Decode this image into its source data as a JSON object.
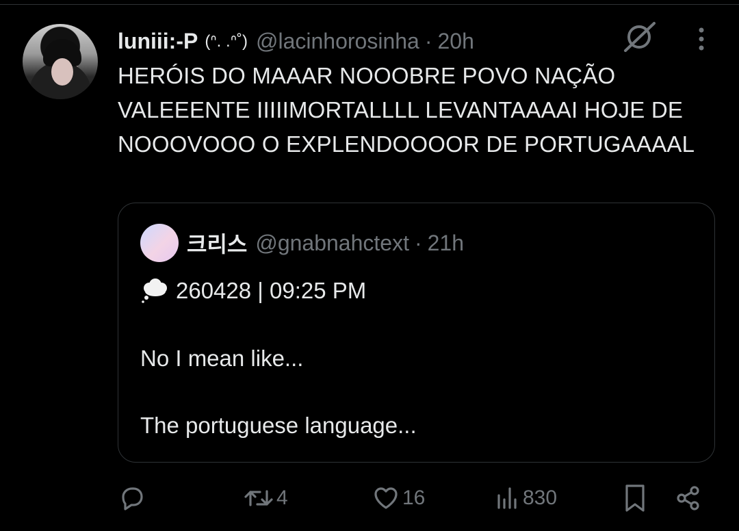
{
  "tweet": {
    "author_name": "luniii:-P",
    "author_emote": "(ᐢ. .ᐢ˚)",
    "handle": "@lacinhorosinha",
    "separator": "·",
    "time": "20h",
    "text": "HERÓIS DO MAAAR NOOOBRE POVO NAÇÃO VALEEENTE IIIIIMORTALLLL LEVANTAAAAI HOJE DE NOOOVOOO O EXPLENDOOOOR DE PORTUGAAAAL"
  },
  "quote": {
    "author_name": "크리스",
    "handle": "@gnabnahctext",
    "separator": "·",
    "time": "21h",
    "line1": "260428 | 09:25 PM",
    "line2": "No I mean like...",
    "line3": "The portuguese language..."
  },
  "actions": {
    "reply_count": "",
    "retweet_count": "4",
    "like_count": "16",
    "views_count": "830"
  },
  "icons": [
    "grok-icon",
    "more-icon",
    "thought-cloud-icon",
    "reply-icon",
    "retweet-icon",
    "like-icon",
    "views-icon",
    "bookmark-icon",
    "share-icon"
  ],
  "colors": {
    "background": "#000000",
    "text": "#e7e9ea",
    "muted": "#71767b",
    "border": "#2f3336"
  }
}
